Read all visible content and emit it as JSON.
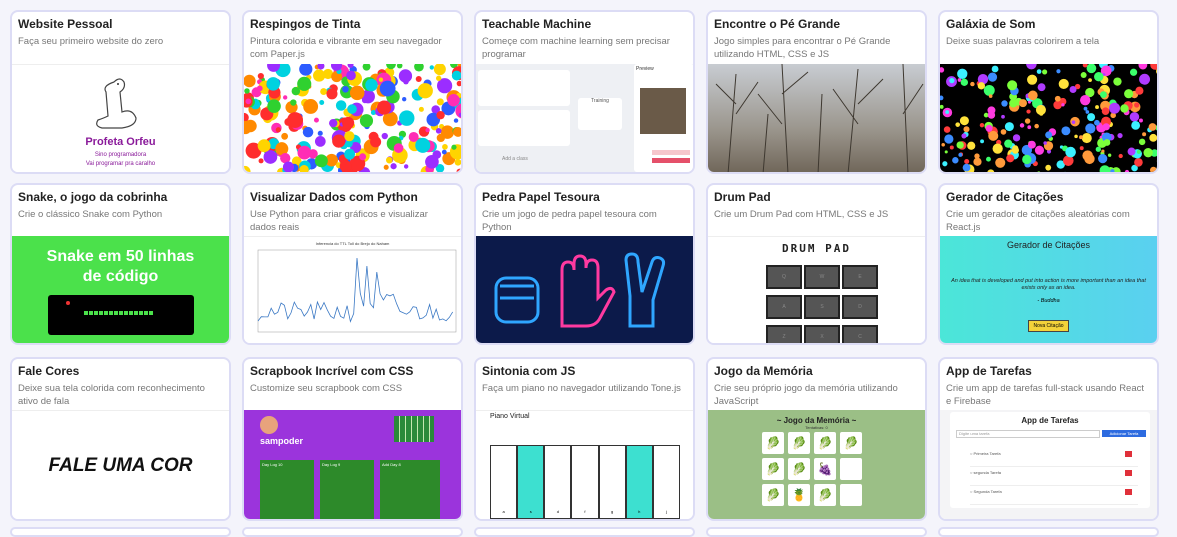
{
  "cards": [
    {
      "title": "Website Pessoal",
      "desc": "Faça seu primeiro website do zero",
      "thumb": {
        "name": "Profeta Orfeu",
        "line1": "Sino programadora",
        "line2": "Vai programar pra caralho"
      }
    },
    {
      "title": "Respingos de Tinta",
      "desc": "Pintura colorida e vibrante em seu navegador com Paper.js"
    },
    {
      "title": "Teachable Machine",
      "desc": "Começe com machine learning sem precisar programar",
      "thumb": {
        "training": "Training",
        "preview": "Preview",
        "add_class": "Add a class"
      }
    },
    {
      "title": "Encontre o Pé Grande",
      "desc": "Jogo simples para encontrar o Pé Grande utilizando HTML, CSS e JS"
    },
    {
      "title": "Galáxia de Som",
      "desc": "Deixe suas palavras colorirem a tela"
    },
    {
      "title": "Snake, o jogo da cobrinha",
      "desc": "Crie o clássico Snake com Python",
      "thumb": {
        "headline": "Snake em 50 linhas de código"
      }
    },
    {
      "title": "Visualizar Dados com Python",
      "desc": "Use Python para criar gráficos e visualizar dados reais",
      "thumb": {
        "chart_title": "Inferencia do TTL Toll do Brejo do Naham"
      }
    },
    {
      "title": "Pedra Papel Tesoura",
      "desc": "Crie um jogo de pedra papel tesoura com Python"
    },
    {
      "title": "Drum Pad",
      "desc": "Crie um Drum Pad com HTML, CSS e JS",
      "thumb": {
        "heading": "DRUM PAD",
        "keys": [
          "Q",
          "W",
          "E",
          "A",
          "S",
          "D",
          "Z",
          "X",
          "C"
        ]
      }
    },
    {
      "title": "Gerador de Citações",
      "desc": "Crie um gerador de citações aleatórias com React.js",
      "thumb": {
        "heading": "Gerador de Citações",
        "quote": "An idea that is developed and put into action is more important than an idea that exists only as an idea.",
        "author": "- Buddha",
        "button": "Nova Citação"
      }
    },
    {
      "title": "Fale Cores",
      "desc": "Deixe sua tela colorida com reconhecimento ativo de fala",
      "thumb": {
        "text": "FALE UMA COR"
      }
    },
    {
      "title": "Scrapbook Incrível com CSS",
      "desc": "Customize seu scrapbook com CSS",
      "thumb": {
        "user": "sampoder",
        "d1": "Day Log 10",
        "d2": "Day Log 9",
        "d3": "Add Day 8"
      }
    },
    {
      "title": "Sintonia com JS",
      "desc": "Faça um piano no navegador utilizando Tone.js",
      "thumb": {
        "heading": "Piano Virtual",
        "keys": [
          "a",
          "s",
          "d",
          "f",
          "g",
          "h",
          "j"
        ]
      }
    },
    {
      "title": "Jogo da Memória",
      "desc": "Crie seu próprio jogo da memória utilizando JavaScript",
      "thumb": {
        "heading": "~ Jogo da Memória ~",
        "sub": "Tentativas: 0"
      }
    },
    {
      "title": "App de Tarefas",
      "desc": "Crie um app de tarefas full-stack usando React e Firebase",
      "thumb": {
        "heading": "App de Tarefas",
        "placeholder": "Digite uma tarefa",
        "button": "Adicionar Tarefa",
        "tasks": [
          "Primeira Tarefa",
          "segunda Tarefa",
          "Segunda Tarefa"
        ]
      }
    }
  ],
  "colors": {
    "border": "#dcdcf5",
    "snake_green": "#4be14b",
    "quote_grad": "#3de0e8",
    "memory_green": "#9bbf86",
    "scrap_purple": "#a23be0"
  }
}
